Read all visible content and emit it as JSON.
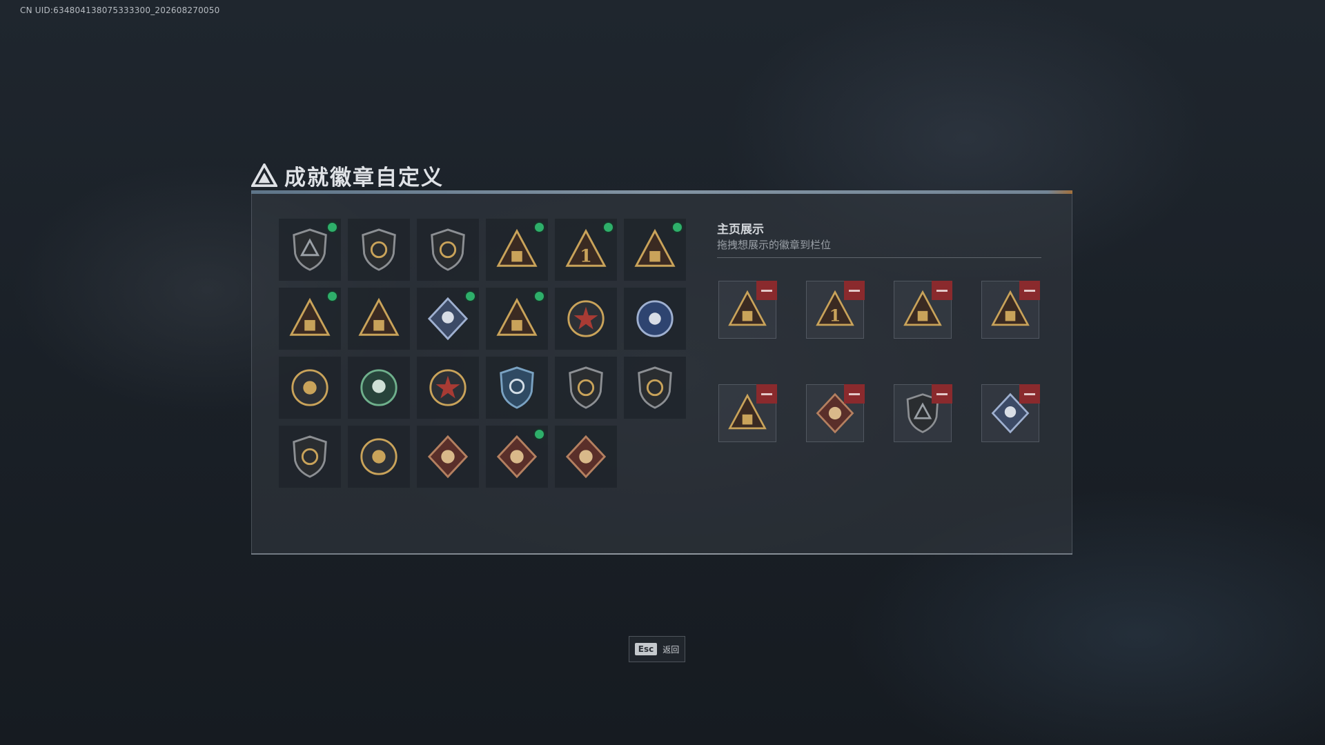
{
  "uid": "CN UID:634804138075333300_202608270050",
  "title": "成就徽章自定义",
  "side": {
    "title": "主页展示",
    "subtitle": "拖拽想展示的徽章到栏位"
  },
  "footer": {
    "key": "Esc",
    "label": "返回"
  },
  "colors": {
    "new_dot": "#2eaf6a",
    "remove": "#8a2a2d",
    "gold": "#c9a35a"
  },
  "badges": [
    {
      "icon": "shield-delta-badge-icon",
      "new": true
    },
    {
      "icon": "helicopter-shield-badge-icon",
      "new": false
    },
    {
      "icon": "winged-shield-badge-icon",
      "new": false
    },
    {
      "icon": "ship-triangle-badge-icon",
      "new": true
    },
    {
      "icon": "number-one-triangle-badge-icon",
      "new": true
    },
    {
      "icon": "supply-crate-triangle-badge-icon",
      "new": true
    },
    {
      "icon": "soldiers-triangle-badge-icon",
      "new": true
    },
    {
      "icon": "dragon-triangle-badge-icon",
      "new": false
    },
    {
      "icon": "rose-diamond-badge-icon",
      "new": true
    },
    {
      "icon": "firefighter-triangle-badge-icon",
      "new": true
    },
    {
      "icon": "star-medal-badge-icon",
      "new": false
    },
    {
      "icon": "blue-medal-badge-icon",
      "new": false
    },
    {
      "icon": "eagle-crest-badge-icon",
      "new": false
    },
    {
      "icon": "green-wreath-badge-icon",
      "new": false
    },
    {
      "icon": "compass-star-badge-icon",
      "new": false
    },
    {
      "icon": "crosshair-shield-badge-icon",
      "new": false
    },
    {
      "icon": "rifle-shield-badge-icon",
      "new": false
    },
    {
      "icon": "rifle-shield-dark-badge-icon",
      "new": false
    },
    {
      "icon": "no-knife-shield-badge-icon",
      "new": false
    },
    {
      "icon": "crossed-rifles-crest-badge-icon",
      "new": false
    },
    {
      "icon": "beast-diamond-badge-icon",
      "new": false
    },
    {
      "icon": "dragon-diamond-badge-icon",
      "new": true
    },
    {
      "icon": "runner-diamond-badge-icon",
      "new": false
    }
  ],
  "showcase": [
    {
      "icon": "supply-crate-triangle-badge-icon"
    },
    {
      "icon": "number-one-triangle-badge-icon"
    },
    {
      "icon": "ship-triangle-badge-icon"
    },
    {
      "icon": "soldiers-triangle-badge-icon"
    },
    {
      "icon": "firefighter-triangle-badge-icon"
    },
    {
      "icon": "dragon-diamond-badge-icon"
    },
    {
      "icon": "shield-delta-badge-icon"
    },
    {
      "icon": "rose-diamond-badge-icon"
    }
  ]
}
